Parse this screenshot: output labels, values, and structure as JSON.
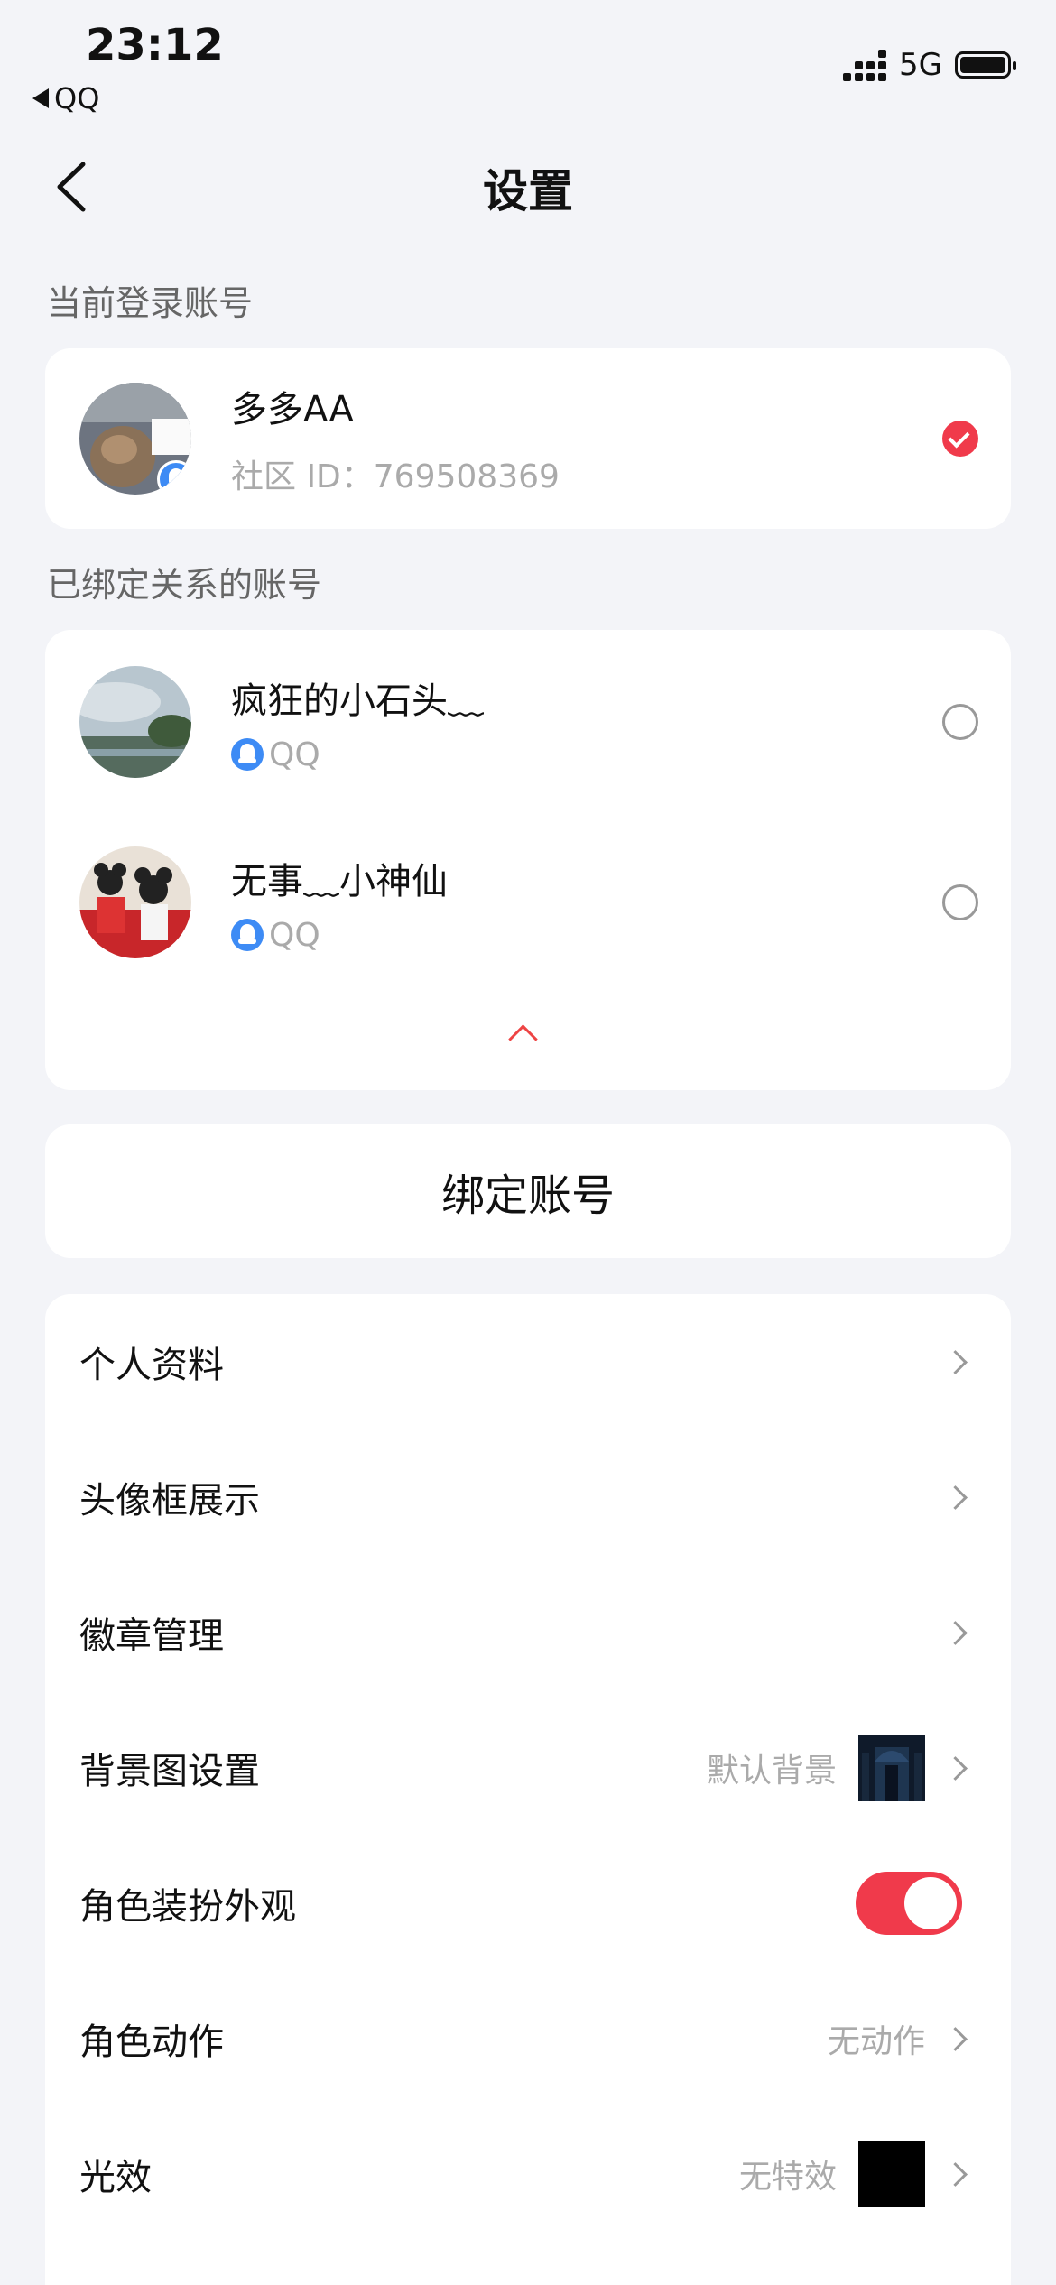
{
  "status_bar": {
    "time": "23:12",
    "back_app": "QQ",
    "network": "5G"
  },
  "nav": {
    "title": "设置"
  },
  "current_account": {
    "section_label": "当前登录账号",
    "name": "多多AA",
    "community_id": "社区 ID：769508369",
    "selected": true
  },
  "bound_accounts": {
    "section_label": "已绑定关系的账号",
    "items": [
      {
        "name": "疯狂的小石头﹏",
        "platform": "QQ"
      },
      {
        "name": "无事﹏小神仙",
        "platform": "QQ"
      }
    ]
  },
  "bind_button": {
    "label": "绑定账号"
  },
  "menu": [
    {
      "label": "个人资料"
    },
    {
      "label": "头像框展示"
    },
    {
      "label": "徽章管理"
    },
    {
      "label": "背景图设置",
      "value": "默认背景"
    },
    {
      "label": "角色装扮外观",
      "toggle": true
    },
    {
      "label": "角色动作",
      "value": "无动作"
    },
    {
      "label": "光效",
      "value": "无特效"
    }
  ],
  "colors": {
    "accent": "#f03a4b",
    "background": "#f3f4f8",
    "qq_blue": "#3d8bf5"
  }
}
